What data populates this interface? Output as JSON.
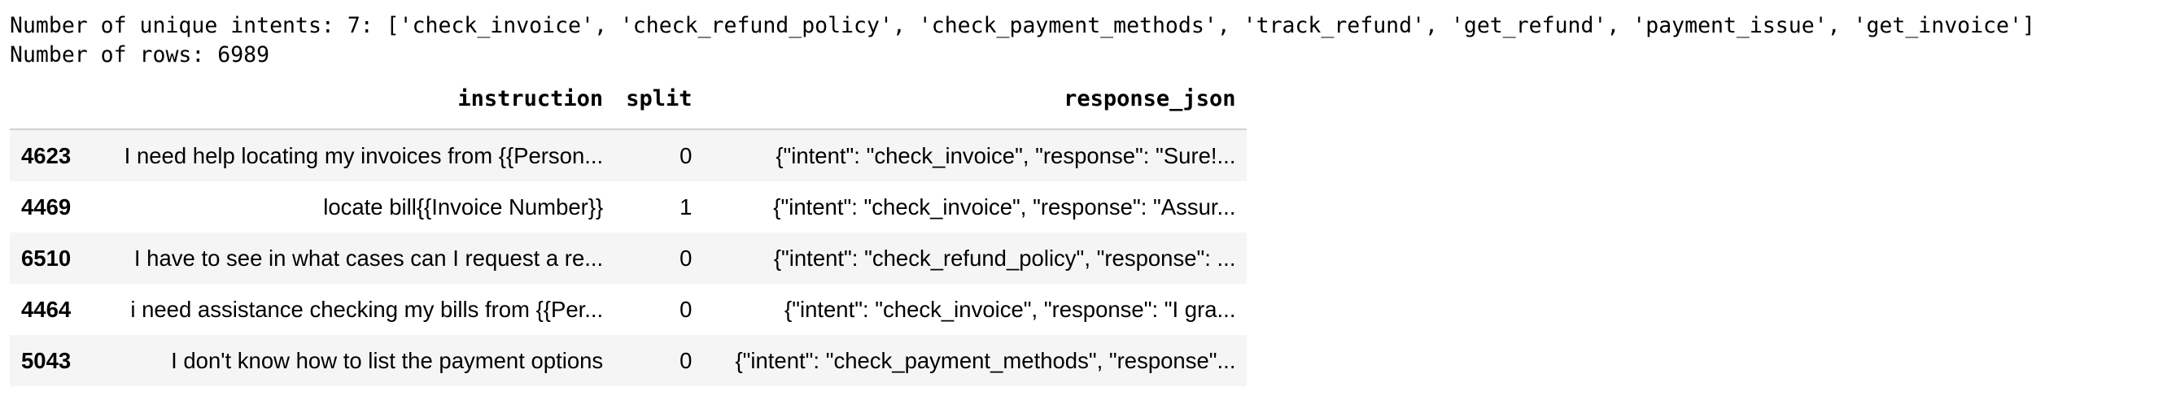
{
  "output": {
    "line_intents": "Number of unique intents: 7: ['check_invoice', 'check_refund_policy', 'check_payment_methods', 'track_refund', 'get_refund', 'payment_issue', 'get_invoice']",
    "line_rows": "Number of rows: 6989"
  },
  "table": {
    "columns": {
      "index": "",
      "instruction": "instruction",
      "split": "split",
      "response_json": "response_json"
    },
    "rows": [
      {
        "index": "4623",
        "instruction": "I need help locating my invoices from {{Person...",
        "split": "0",
        "response_json": "{\"intent\": \"check_invoice\", \"response\": \"Sure!..."
      },
      {
        "index": "4469",
        "instruction": "locate bill{{Invoice Number}}",
        "split": "1",
        "response_json": "{\"intent\": \"check_invoice\", \"response\": \"Assur..."
      },
      {
        "index": "6510",
        "instruction": "I have to see in what cases can I request a re...",
        "split": "0",
        "response_json": "{\"intent\": \"check_refund_policy\", \"response\": ..."
      },
      {
        "index": "4464",
        "instruction": "i need assistance checking my bills from {{Per...",
        "split": "0",
        "response_json": "{\"intent\": \"check_invoice\", \"response\": \"I gra..."
      },
      {
        "index": "5043",
        "instruction": "I don't know how to list the payment options",
        "split": "0",
        "response_json": "{\"intent\": \"check_payment_methods\", \"response\"..."
      }
    ]
  },
  "colors": {
    "striped_row": "#f5f5f5",
    "header_rule": "#d2d2d2",
    "text": "#000000"
  }
}
